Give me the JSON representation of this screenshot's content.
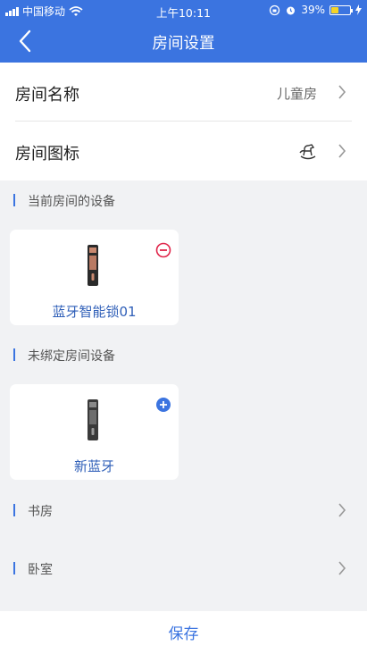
{
  "status_bar": {
    "carrier": "中国移动",
    "time": "上午10:11",
    "battery": "39%",
    "battery_level": 0.39
  },
  "nav": {
    "title": "房间设置",
    "back_icon": "chevron-left-icon"
  },
  "settings": [
    {
      "label": "房间名称",
      "value": "儿童房"
    },
    {
      "label": "房间图标",
      "value": "",
      "icon": "rocking-horse-icon"
    }
  ],
  "current_devices": {
    "heading": "当前房间的设备",
    "items": [
      {
        "name": "蓝牙智能锁01",
        "action_icon": "remove-icon"
      }
    ]
  },
  "unbound_devices": {
    "heading": "未绑定房间设备",
    "items": [
      {
        "name": "新蓝牙",
        "action_icon": "add-icon"
      }
    ]
  },
  "other_rooms": [
    {
      "name": "书房"
    },
    {
      "name": "卧室"
    }
  ],
  "footer": {
    "save_label": "保存"
  },
  "colors": {
    "primary": "#3b74e0",
    "remove": "#e0254a",
    "background": "#f1f2f4"
  }
}
